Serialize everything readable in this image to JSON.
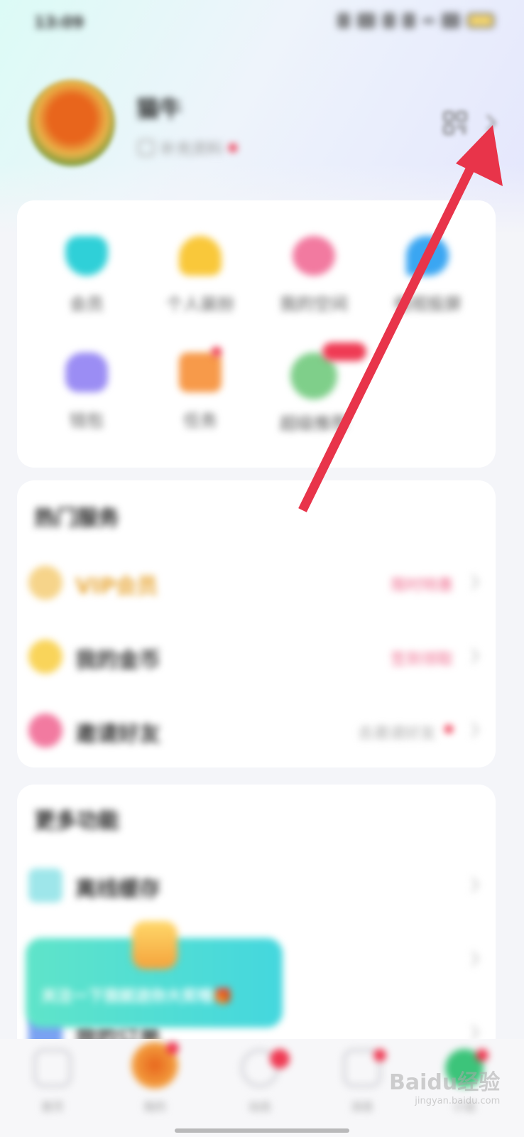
{
  "status_bar": {
    "time": "13:09",
    "signal_label": "4G",
    "battery_color": "#f7d870"
  },
  "profile": {
    "username": "猫牛",
    "subtitle": "补充资料",
    "qr_icon": "qr-code-icon",
    "chevron_icon": "chevron-right-icon"
  },
  "grid": {
    "items": [
      {
        "label": "会员",
        "icon": "gem-icon",
        "color": "#2fd0d8"
      },
      {
        "label": "个人装扮",
        "icon": "bulb-icon",
        "color": "#f9c83a"
      },
      {
        "label": "我的空间",
        "icon": "house-icon",
        "color": "#f27aa0"
      },
      {
        "label": "电视投屏",
        "icon": "eye-icon",
        "color": "#3aa6f2"
      },
      {
        "label": "钱包",
        "icon": "bag-icon",
        "color": "#9b8df4"
      },
      {
        "label": "任务",
        "icon": "gift-icon",
        "color": "#f79a4a"
      },
      {
        "label": "超级推荐",
        "icon": "avatar-icon",
        "color": "#7fcf8a"
      }
    ]
  },
  "hot_services": {
    "title": "热门服务",
    "rows": [
      {
        "label": "VIP会员",
        "right_text": "限时特惠",
        "icon": "crown-icon",
        "color": "#f6d48a"
      },
      {
        "label": "我的金币",
        "right_text": "签到领取",
        "icon": "coin-icon",
        "color": "#f9d45a"
      },
      {
        "label": "邀请好友",
        "right_text": "去邀请好友",
        "icon": "friends-icon",
        "color": "#f27aa0"
      }
    ]
  },
  "more_features": {
    "title": "更多功能",
    "rows": [
      {
        "label": "离线缓存",
        "icon": "download-icon",
        "color": "#9ee6ea"
      },
      {
        "label": "",
        "icon": "blank-icon",
        "color": "#ffffff"
      },
      {
        "label": "我的订单",
        "icon": "order-icon",
        "color": "#7aa2f2"
      }
    ]
  },
  "banner": {
    "text": "关注一下我就送你大奖哦🎁"
  },
  "bottom_nav": {
    "items": [
      {
        "label": "首页",
        "icon": "home-icon"
      },
      {
        "label": "我的",
        "icon": "avatar-tab-icon"
      },
      {
        "label": "动态",
        "icon": "circle-icon"
      },
      {
        "label": "消息",
        "icon": "message-icon"
      },
      {
        "label": "小说",
        "icon": "book-icon"
      }
    ]
  },
  "watermark": {
    "main": "Baidu经验",
    "sub": "jingyan.baidu.com"
  },
  "annotation": {
    "arrow_color": "#e8344a"
  }
}
